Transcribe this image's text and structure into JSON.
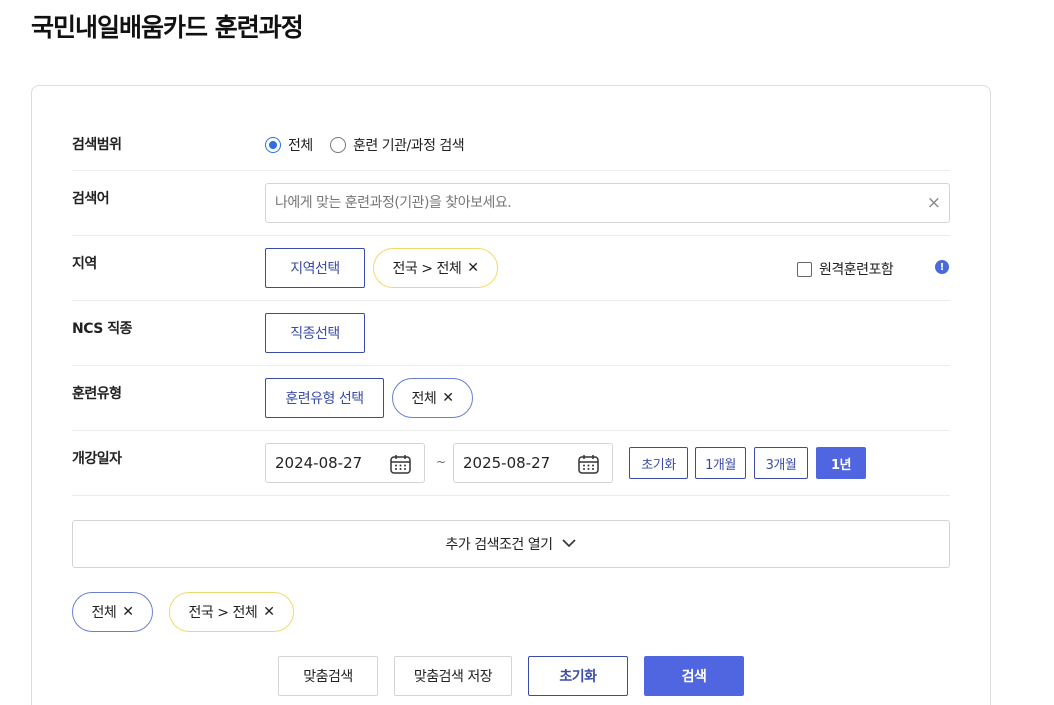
{
  "page": {
    "title": "국민내일배움카드 훈련과정"
  },
  "colors": {
    "accent": "#5066e0",
    "navy": "#3a4ca8",
    "chip_yellow": "#f0d96c",
    "chip_blue": "#6a7fd0",
    "radio_blue": "#2a6fe6"
  },
  "search_scope": {
    "label": "검색범위",
    "options": [
      {
        "label": "전체",
        "selected": true
      },
      {
        "label": "훈련 기관/과정 검색",
        "selected": false
      }
    ]
  },
  "keyword": {
    "label": "검색어",
    "placeholder": "나에게 맞는 훈련과정(기관)을 찾아보세요.",
    "value": "",
    "clear_icon": "close-icon"
  },
  "region": {
    "label": "지역",
    "select_button": "지역선택",
    "chip": "전국 > 전체",
    "remote_checkbox_label": "원격훈련포함",
    "remote_checked": false,
    "info_icon": "info-icon"
  },
  "ncs": {
    "label": "NCS 직종",
    "select_button": "직종선택"
  },
  "training_type": {
    "label": "훈련유형",
    "select_button": "훈련유형 선택",
    "chip": "전체"
  },
  "open_date": {
    "label": "개강일자",
    "start": "2024-08-27",
    "end": "2025-08-27",
    "separator": "~",
    "calendar_icon": "calendar-icon",
    "periods": [
      {
        "label": "초기화",
        "active": false
      },
      {
        "label": "1개월",
        "active": false
      },
      {
        "label": "3개월",
        "active": false
      },
      {
        "label": "1년",
        "active": true
      }
    ]
  },
  "more_conditions": {
    "label": "추가 검색조건 열기",
    "icon": "chevron-down-icon"
  },
  "selected_chips": [
    {
      "label": "전체",
      "style": "blue"
    },
    {
      "label": "전국 > 전체",
      "style": "yellow"
    }
  ],
  "actions": {
    "custom_search": "맞춤검색",
    "save_custom_search": "맞춤검색 저장",
    "reset": "초기화",
    "search": "검색"
  }
}
